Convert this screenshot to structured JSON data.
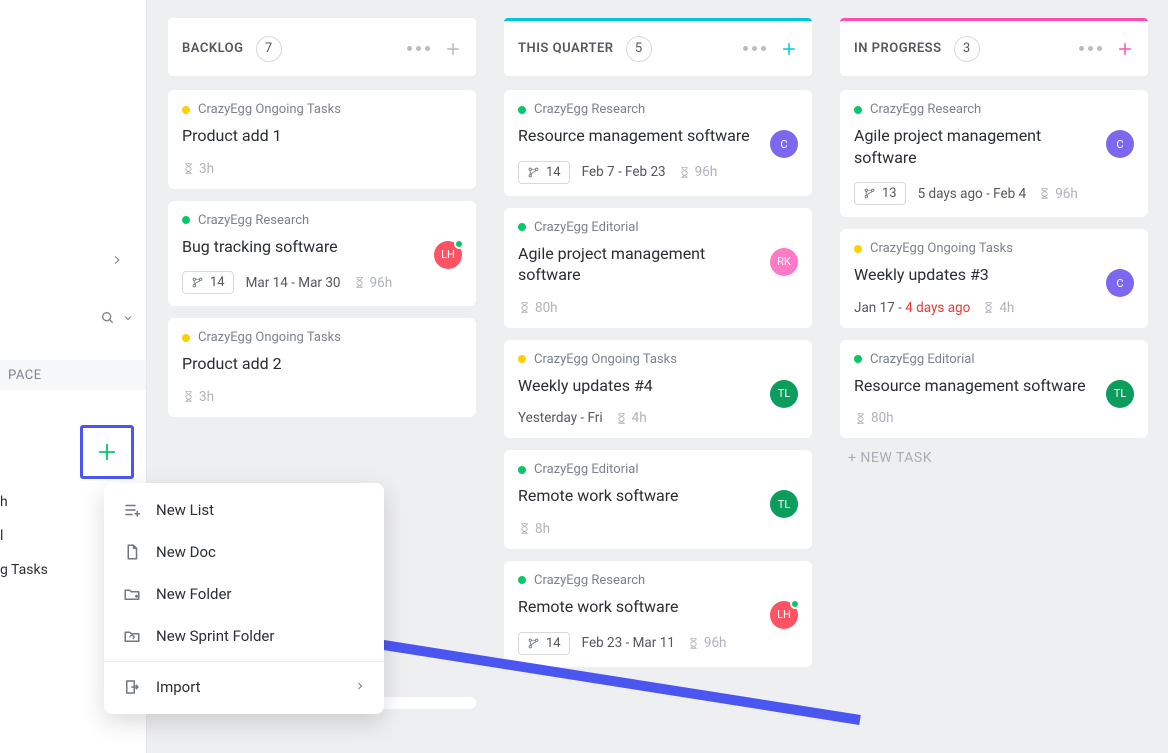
{
  "sidebar": {
    "space_label": "PACE",
    "items": [
      "h",
      "l",
      "g Tasks"
    ]
  },
  "columns": [
    {
      "title": "BACKLOG",
      "count": "7",
      "accent": "none",
      "plus_color": "grey",
      "cards": [
        {
          "dot": "yellow",
          "project": "CrazyEgg Ongoing Tasks",
          "title": "Product add 1",
          "pill": null,
          "dates": "",
          "hours": "3h",
          "avatar": null
        },
        {
          "dot": "green",
          "project": "CrazyEgg Research",
          "title": "Bug tracking software",
          "pill": "14",
          "dates": "Mar 14  -  Mar 30",
          "hours": "96h",
          "avatar": {
            "color": "red",
            "text": "LH",
            "badge": true
          }
        },
        {
          "dot": "yellow",
          "project": "CrazyEgg Ongoing Tasks",
          "title": "Product add 2",
          "pill": null,
          "dates": "",
          "hours": "3h",
          "avatar": null
        }
      ]
    },
    {
      "title": "THIS QUARTER",
      "count": "5",
      "accent": "teal",
      "plus_color": "teal",
      "cards": [
        {
          "dot": "green",
          "project": "CrazyEgg Research",
          "title": "Resource management software",
          "pill": "14",
          "dates": "Feb 7  -  Feb 23",
          "hours": "96h",
          "avatar": {
            "color": "purple",
            "text": "C",
            "badge": false
          }
        },
        {
          "dot": "green",
          "project": "CrazyEgg Editorial",
          "title": "Agile project management software",
          "pill": null,
          "dates": "",
          "hours": "80h",
          "avatar": {
            "color": "pink",
            "text": "RK",
            "badge": false
          }
        },
        {
          "dot": "yellow",
          "project": "CrazyEgg Ongoing Tasks",
          "title": "Weekly updates #4",
          "pill": null,
          "dates": "Yesterday  -  Fri",
          "hours": "4h",
          "avatar": {
            "color": "greenbg",
            "text": "TL",
            "badge": false
          }
        },
        {
          "dot": "green",
          "project": "CrazyEgg Editorial",
          "title": "Remote work software",
          "pill": null,
          "dates": "",
          "hours": "8h",
          "avatar": {
            "color": "greenbg",
            "text": "TL",
            "badge": false
          }
        },
        {
          "dot": "green",
          "project": "CrazyEgg Research",
          "title": "Remote work software",
          "pill": "14",
          "dates": "Feb 23  -  Mar 11",
          "hours": "96h",
          "avatar": {
            "color": "red",
            "text": "LH",
            "badge": true
          }
        }
      ]
    },
    {
      "title": "IN PROGRESS",
      "count": "3",
      "accent": "pink",
      "plus_color": "pink",
      "cards": [
        {
          "dot": "green",
          "project": "CrazyEgg Research",
          "title": "Agile project management software",
          "pill": "13",
          "dates": "5 days ago  -  Feb 4",
          "hours": "96h",
          "avatar": {
            "color": "purple",
            "text": "C",
            "badge": false
          }
        },
        {
          "dot": "yellow",
          "project": "CrazyEgg Ongoing Tasks",
          "title": "Weekly updates #3",
          "pill": null,
          "dates": "Jan 17  -",
          "dates_red": "4 days ago",
          "hours": "4h",
          "avatar": {
            "color": "purple",
            "text": "C",
            "badge": false
          }
        },
        {
          "dot": "green",
          "project": "CrazyEgg Editorial",
          "title": "Resource management software",
          "pill": null,
          "dates": "",
          "hours": "80h",
          "avatar": {
            "color": "greenbg",
            "text": "TL",
            "badge": false
          }
        }
      ],
      "new_task_label": "+ NEW TASK"
    }
  ],
  "popup": {
    "new_list": "New List",
    "new_doc": "New Doc",
    "new_folder": "New Folder",
    "new_sprint_folder": "New Sprint Folder",
    "import": "Import"
  }
}
